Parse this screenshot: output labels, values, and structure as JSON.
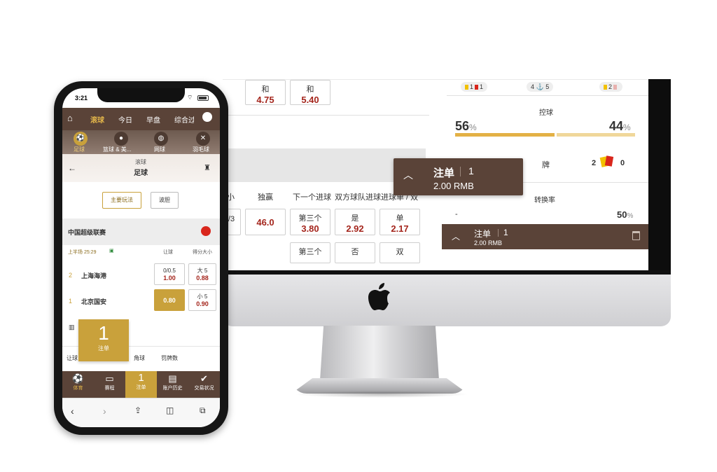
{
  "desktop": {
    "top_cells": [
      {
        "label": "和",
        "odd": "4.75"
      },
      {
        "label": "和",
        "odd": "5.40"
      }
    ],
    "columns": [
      "小",
      "独赢",
      "下一个进球",
      "双方球队进球",
      "进球单 / 双"
    ],
    "row_cells": [
      {
        "label": "/3",
        "odd": ""
      },
      {
        "label": "",
        "odd": "46.0"
      },
      {
        "label": "第三个",
        "odd": "3.80"
      },
      {
        "label": "是",
        "odd": "2.92"
      },
      {
        "label": "单",
        "odd": "2.17"
      }
    ],
    "row2_cells": [
      "第三个",
      "否",
      "双"
    ],
    "stats": {
      "cards_left": [
        "1",
        "1"
      ],
      "corners": "4",
      "corners_right": "5",
      "cards_right": [
        "2",
        "0"
      ],
      "possession_label": "控球",
      "home_possession": "56",
      "away_possession": "44",
      "percent": "%",
      "cards_label": "牌",
      "card_yellow": "2",
      "card_red": "0",
      "conversion_label": "转换率",
      "conversion_left": "-",
      "conversion_right": "50",
      "colors": {
        "home": "#e3b145",
        "away": "#f0d79a"
      }
    },
    "betslip_popup": {
      "title": "注单",
      "count": "1",
      "amount": "2.00 RMB"
    },
    "betslip_bar": {
      "title": "注单",
      "count": "1",
      "amount": "2.00 RMB"
    }
  },
  "phone": {
    "time": "3:21",
    "nav": [
      "滚球",
      "今日",
      "早盘",
      "综合过"
    ],
    "sports": [
      "足球",
      "篮球 & 美...",
      "网球",
      "羽毛球"
    ],
    "sub_top": "滚球",
    "sub_title": "足球",
    "buttons": [
      "主要玩法",
      "波胆"
    ],
    "league": "中国超级联赛",
    "match_time": "上半场 25:29",
    "col_handicap": "让球",
    "col_total": "得分大小",
    "teams": [
      {
        "num": "2",
        "name": "上海海港",
        "hc_line": "0/0.5",
        "hc_odd": "1.00",
        "tot_line": "大 5",
        "tot_odd": "0.88"
      },
      {
        "num": "1",
        "name": "北京国安",
        "hc_line": "",
        "hc_odd": "0.80",
        "tot_line": "小 5",
        "tot_odd": "0.90"
      }
    ],
    "float_slip": {
      "count": "1",
      "label": "注单"
    },
    "bottom_row": [
      "让球",
      "角球",
      "罚牌数"
    ],
    "tabs": [
      "体育",
      "赛程",
      "注单",
      "账户历史",
      "交易状况"
    ],
    "tab_count": "1",
    "accent": "#c9a13b",
    "brand": "#5a4338"
  }
}
